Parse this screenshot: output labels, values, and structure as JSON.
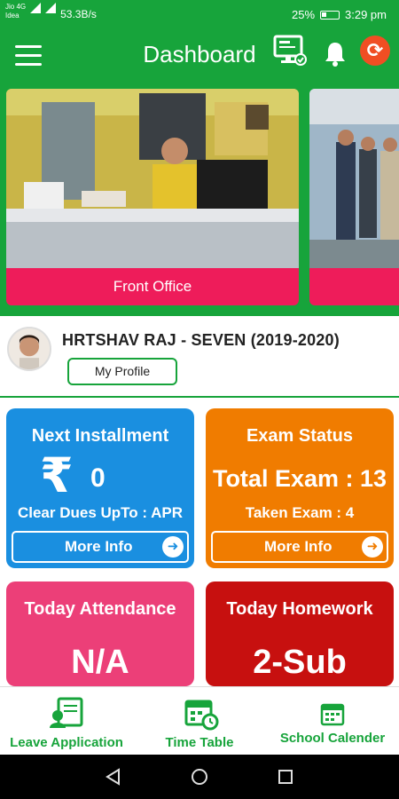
{
  "status_bar": {
    "carrier_top": "Jio 4G",
    "carrier_bottom": "Idea",
    "speed": "53.3B/s",
    "battery": "25%",
    "time": "3:29 pm"
  },
  "app_bar": {
    "title": "Dashboard"
  },
  "banner": {
    "slides": [
      {
        "caption": "Front Office"
      },
      {
        "caption": ""
      }
    ]
  },
  "profile": {
    "name": "HRTSHAV RAJ - SEVEN (2019-2020)",
    "button_label": "My Profile"
  },
  "cards": {
    "installment": {
      "title": "Next Installment",
      "currency_symbol": "₹",
      "amount": "0",
      "dues_text": "Clear Dues UpTo : APR",
      "button_label": "More Info",
      "color": "#1a8fe0"
    },
    "exam": {
      "title": "Exam Status",
      "total_text": "Total Exam : 13",
      "taken_text": "Taken Exam : 4",
      "button_label": "More Info",
      "color": "#f07c00"
    },
    "attendance": {
      "title": "Today Attendance",
      "value": "N/A",
      "color": "#ec3f78"
    },
    "homework": {
      "title": "Today Homework",
      "value": "2-Sub",
      "color": "#c7100f"
    }
  },
  "bottom_nav": {
    "items": [
      {
        "label": "Leave Application",
        "icon": "leave-application-icon"
      },
      {
        "label": "Time Table",
        "icon": "time-table-icon"
      },
      {
        "label": "School Calender",
        "icon": "calendar-icon"
      }
    ]
  },
  "colors": {
    "primary_green": "#17a43b",
    "caption_pink": "#ee1c5a",
    "refresh_orange": "#f04e23"
  }
}
